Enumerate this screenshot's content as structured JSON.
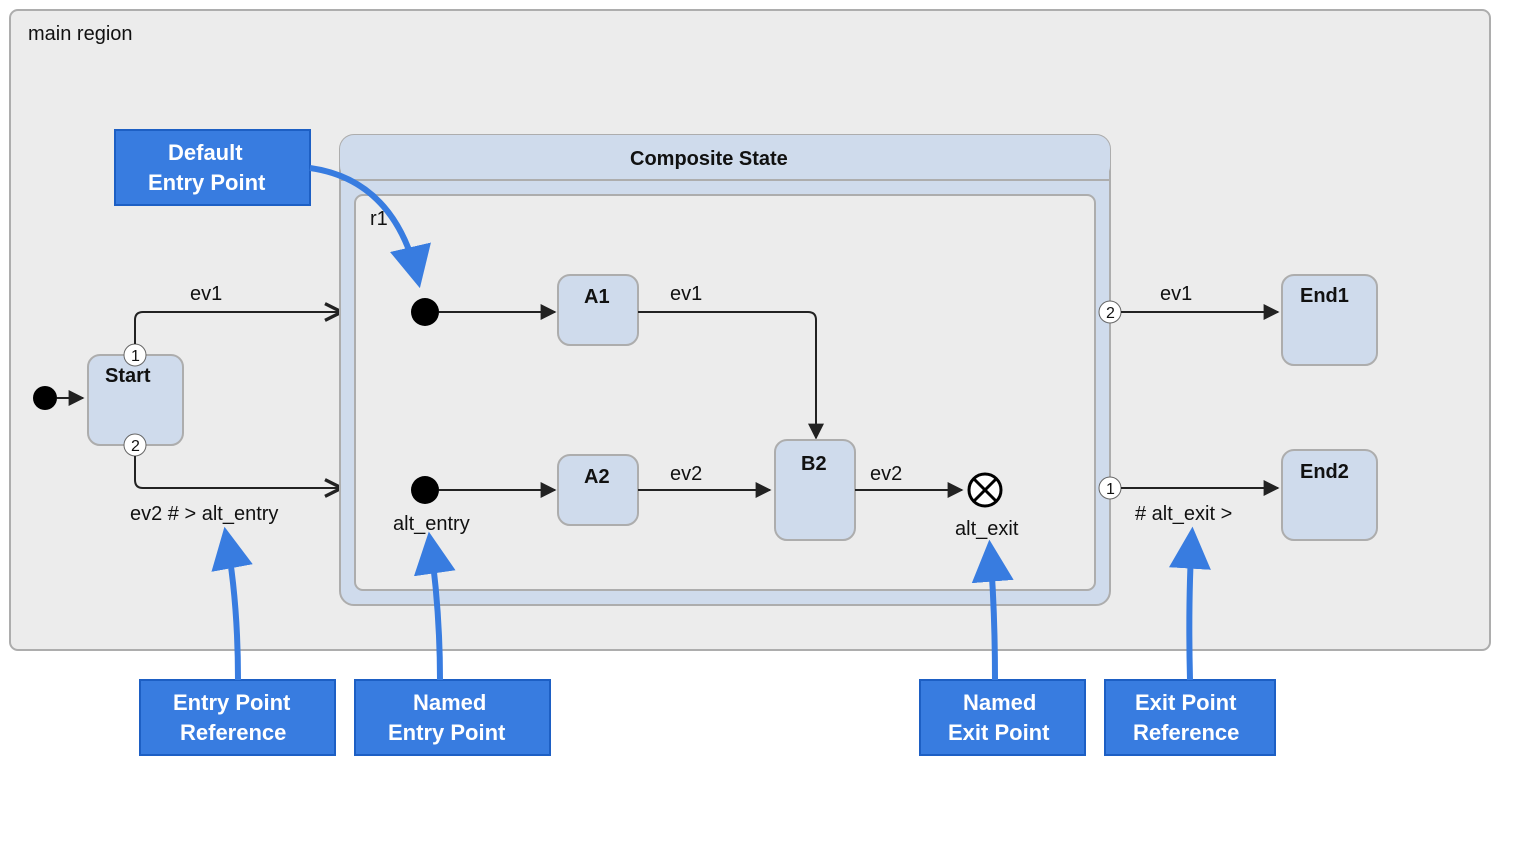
{
  "region": {
    "title": "main region"
  },
  "composite": {
    "title": "Composite State",
    "region": "r1"
  },
  "states": {
    "start": "Start",
    "a1": "A1",
    "a2": "A2",
    "b2": "B2",
    "end1": "End1",
    "end2": "End2"
  },
  "labels": {
    "ev1a": "ev1",
    "ev1b": "ev1",
    "ev1c": "ev1",
    "ev2a": "ev2",
    "ev2b": "ev2",
    "entry_ref": "ev2 # > alt_entry",
    "alt_entry": "alt_entry",
    "alt_exit": "alt_exit",
    "exit_ref": "# alt_exit >"
  },
  "badges": {
    "one_a": "1",
    "two_a": "2",
    "one_b": "1",
    "two_b": "2"
  },
  "callouts": {
    "default_entry": {
      "l1": "Default",
      "l2": "Entry Point"
    },
    "entry_ref": {
      "l1": "Entry Point",
      "l2": "Reference"
    },
    "named_entry": {
      "l1": "Named",
      "l2": "Entry Point"
    },
    "named_exit": {
      "l1": "Named",
      "l2": "Exit Point"
    },
    "exit_ref": {
      "l1": "Exit Point",
      "l2": "Reference"
    }
  }
}
